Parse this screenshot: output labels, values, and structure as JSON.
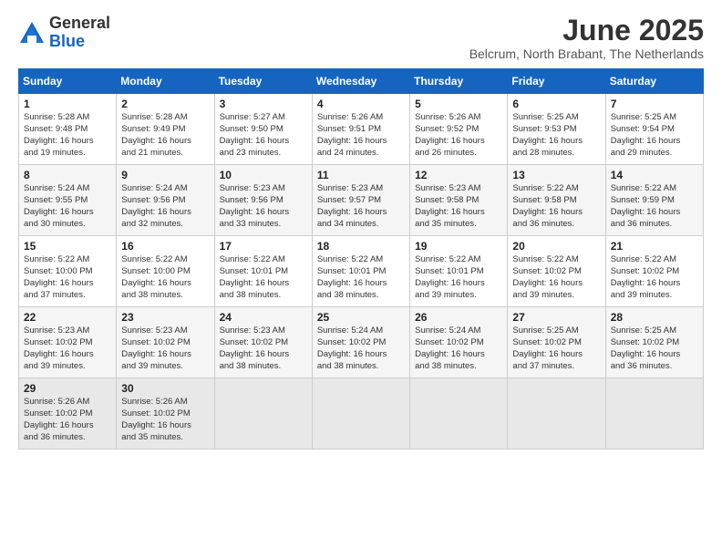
{
  "logo": {
    "general": "General",
    "blue": "Blue"
  },
  "title": "June 2025",
  "subtitle": "Belcrum, North Brabant, The Netherlands",
  "headers": [
    "Sunday",
    "Monday",
    "Tuesday",
    "Wednesday",
    "Thursday",
    "Friday",
    "Saturday"
  ],
  "weeks": [
    [
      {
        "day": "1",
        "info": "Sunrise: 5:28 AM\nSunset: 9:48 PM\nDaylight: 16 hours\nand 19 minutes."
      },
      {
        "day": "2",
        "info": "Sunrise: 5:28 AM\nSunset: 9:49 PM\nDaylight: 16 hours\nand 21 minutes."
      },
      {
        "day": "3",
        "info": "Sunrise: 5:27 AM\nSunset: 9:50 PM\nDaylight: 16 hours\nand 23 minutes."
      },
      {
        "day": "4",
        "info": "Sunrise: 5:26 AM\nSunset: 9:51 PM\nDaylight: 16 hours\nand 24 minutes."
      },
      {
        "day": "5",
        "info": "Sunrise: 5:26 AM\nSunset: 9:52 PM\nDaylight: 16 hours\nand 26 minutes."
      },
      {
        "day": "6",
        "info": "Sunrise: 5:25 AM\nSunset: 9:53 PM\nDaylight: 16 hours\nand 28 minutes."
      },
      {
        "day": "7",
        "info": "Sunrise: 5:25 AM\nSunset: 9:54 PM\nDaylight: 16 hours\nand 29 minutes."
      }
    ],
    [
      {
        "day": "8",
        "info": "Sunrise: 5:24 AM\nSunset: 9:55 PM\nDaylight: 16 hours\nand 30 minutes."
      },
      {
        "day": "9",
        "info": "Sunrise: 5:24 AM\nSunset: 9:56 PM\nDaylight: 16 hours\nand 32 minutes."
      },
      {
        "day": "10",
        "info": "Sunrise: 5:23 AM\nSunset: 9:56 PM\nDaylight: 16 hours\nand 33 minutes."
      },
      {
        "day": "11",
        "info": "Sunrise: 5:23 AM\nSunset: 9:57 PM\nDaylight: 16 hours\nand 34 minutes."
      },
      {
        "day": "12",
        "info": "Sunrise: 5:23 AM\nSunset: 9:58 PM\nDaylight: 16 hours\nand 35 minutes."
      },
      {
        "day": "13",
        "info": "Sunrise: 5:22 AM\nSunset: 9:58 PM\nDaylight: 16 hours\nand 36 minutes."
      },
      {
        "day": "14",
        "info": "Sunrise: 5:22 AM\nSunset: 9:59 PM\nDaylight: 16 hours\nand 36 minutes."
      }
    ],
    [
      {
        "day": "15",
        "info": "Sunrise: 5:22 AM\nSunset: 10:00 PM\nDaylight: 16 hours\nand 37 minutes."
      },
      {
        "day": "16",
        "info": "Sunrise: 5:22 AM\nSunset: 10:00 PM\nDaylight: 16 hours\nand 38 minutes."
      },
      {
        "day": "17",
        "info": "Sunrise: 5:22 AM\nSunset: 10:01 PM\nDaylight: 16 hours\nand 38 minutes."
      },
      {
        "day": "18",
        "info": "Sunrise: 5:22 AM\nSunset: 10:01 PM\nDaylight: 16 hours\nand 38 minutes."
      },
      {
        "day": "19",
        "info": "Sunrise: 5:22 AM\nSunset: 10:01 PM\nDaylight: 16 hours\nand 39 minutes."
      },
      {
        "day": "20",
        "info": "Sunrise: 5:22 AM\nSunset: 10:02 PM\nDaylight: 16 hours\nand 39 minutes."
      },
      {
        "day": "21",
        "info": "Sunrise: 5:22 AM\nSunset: 10:02 PM\nDaylight: 16 hours\nand 39 minutes."
      }
    ],
    [
      {
        "day": "22",
        "info": "Sunrise: 5:23 AM\nSunset: 10:02 PM\nDaylight: 16 hours\nand 39 minutes."
      },
      {
        "day": "23",
        "info": "Sunrise: 5:23 AM\nSunset: 10:02 PM\nDaylight: 16 hours\nand 39 minutes."
      },
      {
        "day": "24",
        "info": "Sunrise: 5:23 AM\nSunset: 10:02 PM\nDaylight: 16 hours\nand 38 minutes."
      },
      {
        "day": "25",
        "info": "Sunrise: 5:24 AM\nSunset: 10:02 PM\nDaylight: 16 hours\nand 38 minutes."
      },
      {
        "day": "26",
        "info": "Sunrise: 5:24 AM\nSunset: 10:02 PM\nDaylight: 16 hours\nand 38 minutes."
      },
      {
        "day": "27",
        "info": "Sunrise: 5:25 AM\nSunset: 10:02 PM\nDaylight: 16 hours\nand 37 minutes."
      },
      {
        "day": "28",
        "info": "Sunrise: 5:25 AM\nSunset: 10:02 PM\nDaylight: 16 hours\nand 36 minutes."
      }
    ],
    [
      {
        "day": "29",
        "info": "Sunrise: 5:26 AM\nSunset: 10:02 PM\nDaylight: 16 hours\nand 36 minutes."
      },
      {
        "day": "30",
        "info": "Sunrise: 5:26 AM\nSunset: 10:02 PM\nDaylight: 16 hours\nand 35 minutes."
      },
      {
        "day": "",
        "info": ""
      },
      {
        "day": "",
        "info": ""
      },
      {
        "day": "",
        "info": ""
      },
      {
        "day": "",
        "info": ""
      },
      {
        "day": "",
        "info": ""
      }
    ]
  ]
}
